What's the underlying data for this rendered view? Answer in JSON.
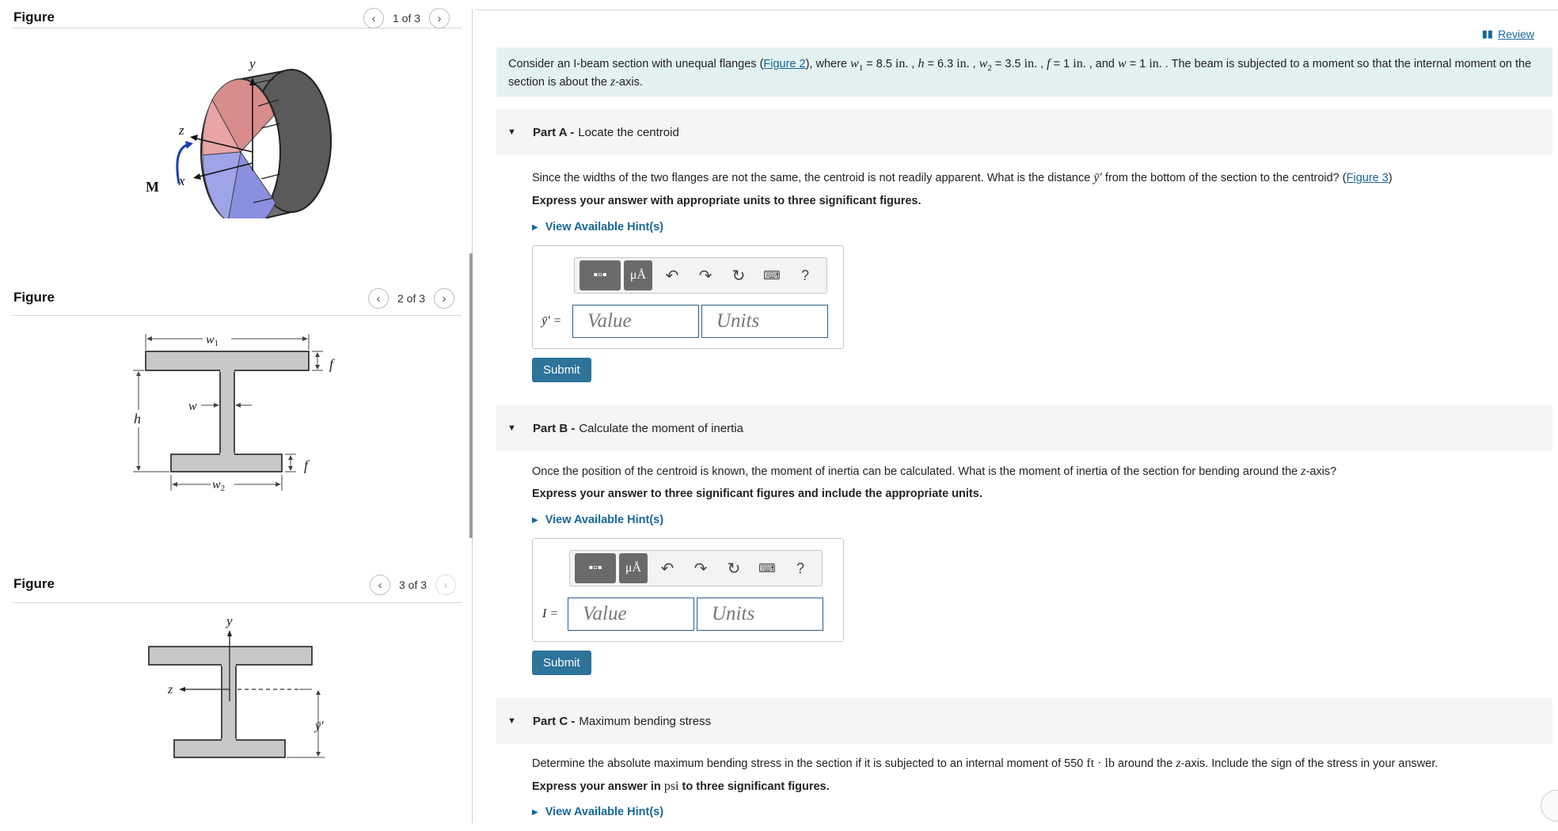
{
  "figures": [
    {
      "title": "Figure",
      "counter": "1 of 3",
      "labels": {
        "y": "y",
        "z": "z",
        "x": "x",
        "M": "M"
      }
    },
    {
      "title": "Figure",
      "counter": "2 of 3",
      "labels": {
        "w1": "w",
        "w1sub": "1",
        "f": "f",
        "h": "h",
        "w": "w",
        "w2": "w",
        "w2sub": "2"
      }
    },
    {
      "title": "Figure",
      "counter": "3 of 3",
      "labels": {
        "y": "y",
        "z": "z",
        "ybar": "ȳ′"
      }
    }
  ],
  "review": {
    "label": "Review"
  },
  "problem": {
    "t1": "Consider an I-beam section with unequal flanges (",
    "fig_link": "Figure 2",
    "t2": "), where ",
    "w1": "w",
    "w1_sub": "1",
    "w1_val": " = 8.5 ",
    "w1_unit": "in.",
    "sep1": " , ",
    "h": "h",
    "h_val": " = 6.3 ",
    "h_unit": "in.",
    "sep2": " , ",
    "w2": "w",
    "w2_sub": "2",
    "w2_val": " = 3.5 ",
    "w2_unit": "in.",
    "sep3": " , ",
    "f": "f",
    "f_val": " = 1 ",
    "f_unit": "in.",
    "and": " , and ",
    "w": "w",
    "w_val": " = 1 ",
    "w_unit": "in.",
    "t3": " . The beam is subjected to a moment so that the internal moment on the section is about the ",
    "axis": "z",
    "t4": "-axis."
  },
  "parts": [
    {
      "label": "Part A -",
      "title": "Locate the centroid",
      "q1": "Since the widths of the two flanges are not the same, the centroid is not readily apparent. What is the distance ",
      "qsym": "ȳ′",
      "q2": " from the bottom of the section to the centroid? (",
      "qlink": "Figure 3",
      "q3": ")",
      "instruction": "Express your answer with appropriate units to three significant figures.",
      "hint": "View Available Hint(s)",
      "var": "ȳ′ =",
      "value_placeholder": "Value",
      "units_placeholder": "Units",
      "submit": "Submit"
    },
    {
      "label": "Part B -",
      "title": "Calculate the moment of inertia",
      "q1": "Once the position of the centroid is known, the moment of inertia can be calculated. What is the moment of inertia of the section for bending around the ",
      "axis": "z",
      "q2": "-axis?",
      "instruction": "Express your answer to three significant figures and include the appropriate units.",
      "hint": "View Available Hint(s)",
      "var": "I =",
      "value_placeholder": "Value",
      "units_placeholder": "Units",
      "submit": "Submit"
    },
    {
      "label": "Part C -",
      "title": "Maximum bending stress",
      "q1": "Determine the absolute maximum bending stress in the section if it is subjected to an internal moment of 550 ",
      "qunit": "ft · lb",
      "q2": " around the ",
      "axis": "z",
      "q3": "-axis. Include the sign of the stress in your answer.",
      "ins1": "Express your answer in ",
      "ins_unit": "psi",
      "ins2": " to three significant figures.",
      "hint": "View Available Hint(s)"
    }
  ],
  "toolbar": {
    "units_btn": "μÅ",
    "help": "?"
  },
  "colors": {
    "accent": "#17679a",
    "submit": "#2e7399",
    "problem_bg": "#e3f2f1",
    "part_bg": "#f5f5f5"
  }
}
